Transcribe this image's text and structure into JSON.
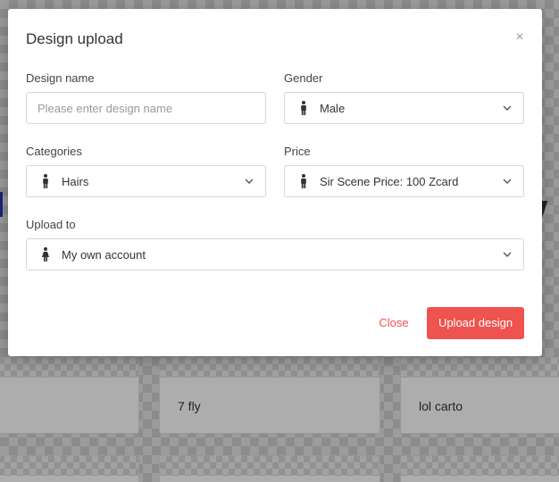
{
  "background": {
    "cards": [
      {
        "title": ""
      },
      {
        "title": "7 fly"
      },
      {
        "title": "lol carto"
      }
    ]
  },
  "modal": {
    "title": "Design upload",
    "close_icon": "close-icon",
    "design_name": {
      "label": "Design name",
      "value": "",
      "placeholder": "Please enter design name"
    },
    "gender": {
      "label": "Gender",
      "value": "Male",
      "icon": "male-person-icon"
    },
    "categories": {
      "label": "Categories",
      "value": "Hairs",
      "icon": "person-icon"
    },
    "price": {
      "label": "Price",
      "value": "Sir Scene Price: 100 Zcard",
      "icon": "person-icon"
    },
    "upload_to": {
      "label": "Upload to",
      "value": "My own account",
      "icon": "female-person-icon"
    },
    "buttons": {
      "close": "Close",
      "upload": "Upload design"
    }
  },
  "colors": {
    "accent": "#ef5350",
    "text": "#333333",
    "border": "#d7d7d7"
  }
}
